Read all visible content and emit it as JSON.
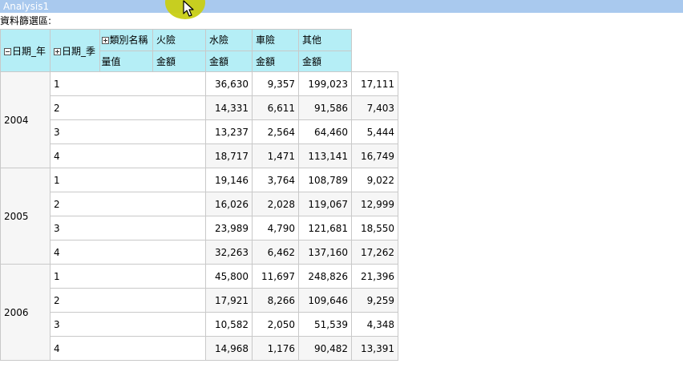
{
  "window": {
    "title": "Analysis1"
  },
  "filter_area": {
    "label": "資料篩選區:"
  },
  "pivot": {
    "row_headers": {
      "year": "日期_年",
      "quarter": "日期_季"
    },
    "category_header": "類別名稱",
    "measure_label": "量值",
    "columns": [
      "火險",
      "水險",
      "車險",
      "其他"
    ],
    "measure_name": "金額",
    "rows": [
      {
        "year": "2004",
        "quarters": [
          {
            "q": "1",
            "values": [
              "36,630",
              "9,357",
              "199,023",
              "17,111"
            ]
          },
          {
            "q": "2",
            "values": [
              "14,331",
              "6,611",
              "91,586",
              "7,403"
            ]
          },
          {
            "q": "3",
            "values": [
              "13,237",
              "2,564",
              "64,460",
              "5,444"
            ]
          },
          {
            "q": "4",
            "values": [
              "18,717",
              "1,471",
              "113,141",
              "16,749"
            ]
          }
        ]
      },
      {
        "year": "2005",
        "quarters": [
          {
            "q": "1",
            "values": [
              "19,146",
              "3,764",
              "108,789",
              "9,022"
            ]
          },
          {
            "q": "2",
            "values": [
              "16,026",
              "2,028",
              "119,067",
              "12,999"
            ]
          },
          {
            "q": "3",
            "values": [
              "23,989",
              "4,790",
              "121,681",
              "18,550"
            ]
          },
          {
            "q": "4",
            "values": [
              "32,263",
              "6,462",
              "137,160",
              "17,262"
            ]
          }
        ]
      },
      {
        "year": "2006",
        "quarters": [
          {
            "q": "1",
            "values": [
              "45,800",
              "11,697",
              "248,826",
              "21,396"
            ]
          },
          {
            "q": "2",
            "values": [
              "17,921",
              "8,266",
              "109,646",
              "9,259"
            ]
          },
          {
            "q": "3",
            "values": [
              "10,582",
              "2,050",
              "51,539",
              "4,348"
            ]
          },
          {
            "q": "4",
            "values": [
              "14,968",
              "1,176",
              "90,482",
              "13,391"
            ]
          }
        ]
      }
    ]
  },
  "colors": {
    "header_bg": "#b5eef6",
    "titlebar_bg": "#a9c9ee",
    "band_bg": "#f6f6f6"
  }
}
